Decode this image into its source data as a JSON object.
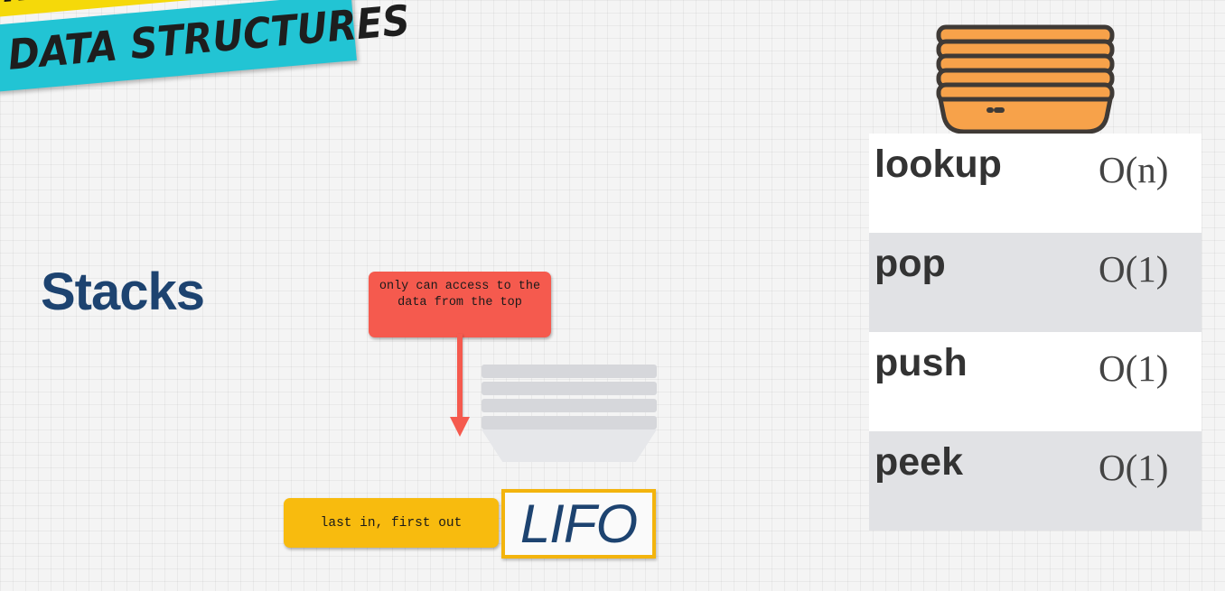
{
  "banner": {
    "top_text": "INTERVIEW",
    "main_text": "DATA STRUCTURES"
  },
  "title": "Stacks",
  "callout": {
    "text": "only can access to the data from the top"
  },
  "note": {
    "text": "last in, first out"
  },
  "lifo": "LIFO",
  "operations": [
    {
      "name": "lookup",
      "complexity": "O(n)"
    },
    {
      "name": "pop",
      "complexity": "O(1)"
    },
    {
      "name": "push",
      "complexity": "O(1)"
    },
    {
      "name": "peek",
      "complexity": "O(1)"
    }
  ],
  "colors": {
    "title_blue": "#1d4370",
    "callout_red": "#f55a4e",
    "note_yellow": "#f8bb0e",
    "stack_orange": "#f7a24a",
    "banner_cyan": "#22c4d4",
    "banner_yellow": "#f5d90a"
  },
  "icons": {
    "stack_icon": "plate-stack-icon",
    "faded_stack": "faded-plate-stack-icon",
    "arrow": "down-arrow-icon"
  }
}
